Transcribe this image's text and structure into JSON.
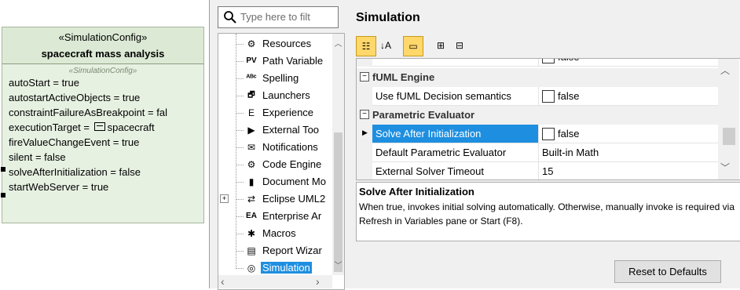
{
  "diagram": {
    "stereotype": "«SimulationConfig»",
    "name": "spacecraft mass analysis",
    "sub_stereotype": "«SimulationConfig»",
    "properties": [
      "autoStart = true",
      "autostartActiveObjects = true",
      "constraintFailureAsBreakpoint = fal",
      "executionTarget = ",
      "fireValueChangeEvent = true",
      "silent = false",
      "solveAfterInitialization = false",
      "startWebServer = true"
    ],
    "execution_target_value": "spacecraft"
  },
  "search": {
    "placeholder": "Type here to filt"
  },
  "tree": {
    "items": [
      {
        "label": "Resources",
        "icon": "resources-icon",
        "glyph": "⚙"
      },
      {
        "label": "Path Variable",
        "icon": "path-variable-icon",
        "glyph": "PV"
      },
      {
        "label": "Spelling",
        "icon": "spelling-icon",
        "glyph": "ᴬᴮᶜ"
      },
      {
        "label": "Launchers",
        "icon": "launchers-icon",
        "glyph": "🗗"
      },
      {
        "label": "Experience",
        "icon": "experience-icon",
        "glyph": "E"
      },
      {
        "label": "External Too",
        "icon": "external-tools-icon",
        "glyph": "▶"
      },
      {
        "label": "Notifications",
        "icon": "notifications-icon",
        "glyph": "✉"
      },
      {
        "label": "Code Engine",
        "icon": "code-engine-icon",
        "glyph": "⚙"
      },
      {
        "label": "Document Mo",
        "icon": "document-model-icon",
        "glyph": "▮"
      },
      {
        "label": "Eclipse UML2",
        "icon": "eclipse-uml2-icon",
        "glyph": "⇄"
      },
      {
        "label": "Enterprise Ar",
        "icon": "enterprise-architect-icon",
        "glyph": "EA"
      },
      {
        "label": "Macros",
        "icon": "macros-icon",
        "glyph": "✱"
      },
      {
        "label": "Report Wizar",
        "icon": "report-wizard-icon",
        "glyph": "▤"
      },
      {
        "label": "Simulation",
        "icon": "simulation-icon",
        "glyph": "◎"
      }
    ],
    "selected_index": 13
  },
  "panel": {
    "title": "Simulation",
    "toolbar": [
      {
        "name": "categorized-view-icon",
        "glyph": "☷",
        "active": true
      },
      {
        "name": "sort-alphabetical-icon",
        "glyph": "↓A",
        "active": false
      },
      {
        "name": "description-toggle-icon",
        "glyph": "▭",
        "active": true
      },
      {
        "name": "expand-all-icon",
        "glyph": "⊞",
        "active": false
      },
      {
        "name": "collapse-all-icon",
        "glyph": "⊟",
        "active": false
      }
    ],
    "grid": {
      "partial_row_value": "false",
      "fuml_category": "fUML Engine",
      "fuml_decision_label": "Use fUML Decision semantics",
      "fuml_decision_value": "false",
      "param_category": "Parametric Evaluator",
      "solve_label": "Solve After Initialization",
      "solve_value": "false",
      "default_eval_label": "Default Parametric Evaluator",
      "default_eval_value": "Built-in Math",
      "timeout_label": "External Solver Timeout",
      "timeout_value": "15"
    },
    "description": {
      "title": "Solve After Initialization",
      "text": "When true, invokes initial solving automatically. Otherwise, manually invoke is required via Refresh in Variables pane or Start (F8)."
    },
    "reset_label": "Reset to Defaults"
  },
  "colors": {
    "selection": "#1e8fe0",
    "block_fill": "#e7f1e2",
    "toolbar_active": "#ffd76a"
  }
}
